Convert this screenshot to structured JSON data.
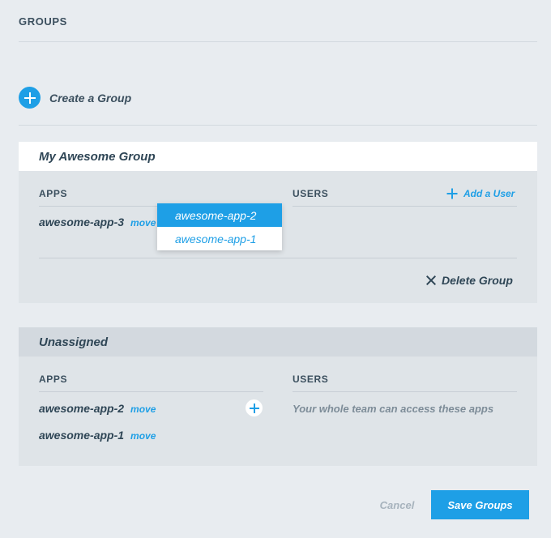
{
  "page": {
    "title": "GROUPS"
  },
  "create_group": {
    "label": "Create a Group"
  },
  "groups": [
    {
      "name": "My Awesome Group",
      "apps_label": "APPS",
      "users_label": "USERS",
      "add_user_label": "Add a User",
      "apps": [
        {
          "name": "awesome-app-3",
          "move_label": "move"
        }
      ],
      "delete_label": "Delete Group"
    },
    {
      "name": "Unassigned",
      "apps_label": "APPS",
      "users_label": "USERS",
      "users_note": "Your whole team can access these apps",
      "apps": [
        {
          "name": "awesome-app-2",
          "move_label": "move"
        },
        {
          "name": "awesome-app-1",
          "move_label": "move"
        }
      ]
    }
  ],
  "dropdown": {
    "options": [
      "awesome-app-2",
      "awesome-app-1"
    ],
    "highlighted_index": 0
  },
  "footer": {
    "cancel_label": "Cancel",
    "save_label": "Save Groups"
  },
  "colors": {
    "accent": "#1e9fe6",
    "background": "#e8ecf0",
    "card": "#dfe4e8",
    "text": "#2f4656",
    "muted": "#7d8c98"
  }
}
